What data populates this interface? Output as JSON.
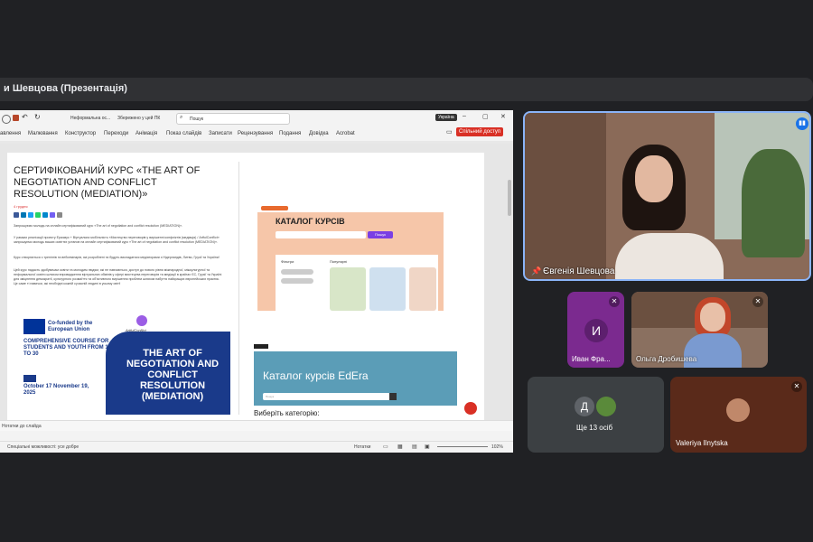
{
  "meeting": {
    "presenter_bar": "и Шевцова (Презентація)"
  },
  "presentation_app": {
    "filename": "Неформальна ос...",
    "saved_status": "Збережено у цей ПК",
    "search_placeholder": "Пошук",
    "user_badge": "Україна",
    "menu": [
      "авлення",
      "Малювання",
      "Конструктор",
      "Переходи",
      "Анімація",
      "Показ слайдів",
      "Записати",
      "Рецензування",
      "Подання",
      "Довідка",
      "Acrobat"
    ],
    "share_button": "Спільний доступ",
    "notes_placeholder": "Нотатки до слайда",
    "status_left": "Спеціальні можливості: усе добре",
    "status_notes": "Нотатки",
    "zoom": "102%"
  },
  "slide": {
    "title": "СЕРТИФІКОВАНИЙ КУРС «THE ART OF NEGOTIATION AND CONFLICT RESOLUTION (MEDIATION)»",
    "date": "4 грудня",
    "paragraph1": "Запрошуємо молодь на онлайн сертифікований курс «The art of negotiation and conflict resolution (MEDIATION)».",
    "paragraph2": "У рамках реалізації проекту Еразмус + Віртуальна мобільність «Мистецтво переговорів у вирішенні конфліктів (медіація) / ArtfulConflict» запрошуємо молодь ваших освітніх установ на онлайн сертифікований курс «The art of negotiation and conflict resolution (MEDIATION)».",
    "paragraph3": "Курс створюється з тренінгів та вебсемінарів, які розроблені та будуть викладатися медіаторами з Нідерландів, Литви, Грузії та України!",
    "paragraph4": "Цей курс надасть здобувачам освіти та молодим людям, які не навчаються, доступ до нового рівня міжнародної, міжкультурної та неформальної освіти шляхом впровадження віртуальних обмінів у сфері мистецтва переговорів та медіації в країнах ЄС, Грузії та Україні для зміцнення демократії, культурного розмаїття та об'єктивного вирішення проблем шляхом набуття найкращих європейських практик. Це саме ті навички, які необхідні кожній сучасній людині в усьому світі!",
    "banner": {
      "cofunded": "Co-funded by the European Union",
      "course": "COMPREHENSIVE COURSE FOR STUDENTS AND YOUTH FROM 18 TO 30",
      "main": "THE ART OF NEGOTIATION AND CONFLICT RESOLUTION (MEDIATION)",
      "dates": "October 17 November 19, 2025",
      "logo_text": "ArtfulConflict"
    },
    "catalog1": {
      "title": "КАТАЛОГ КУРСІВ",
      "button": "Пошук",
      "filters": "Фільтри",
      "popular": "Популярні"
    },
    "catalog2": {
      "title": "Каталог курсів EdEra",
      "search_placeholder": "Пошук",
      "subtitle": "Виберіть категорію:"
    }
  },
  "participants": {
    "main": "Євгенія Шевцова",
    "ivan": "Иван Фра...",
    "ivan_initial": "И",
    "olga": "Ольга Дробишева",
    "more_initial": "Д",
    "more": "Ще 13 осіб",
    "valeriya": "Valeriya Ilnytska"
  },
  "colors": {
    "accent_red": "#d93025",
    "purple_tile": "#7b2a8f",
    "speaker_border": "#8ab4f8"
  }
}
